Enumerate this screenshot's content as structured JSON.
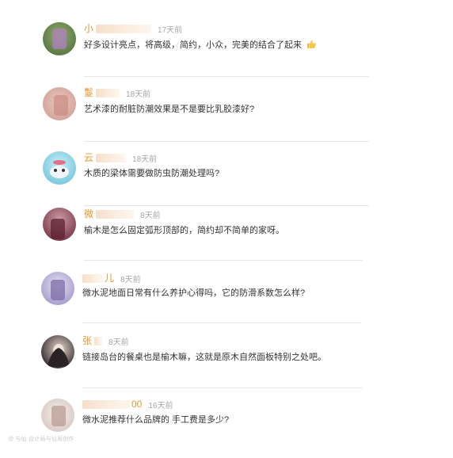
{
  "comments": [
    {
      "name": "小",
      "time": "17天前",
      "text": "好多设计亮点，将高级，简约，小众，完美的结合了起来",
      "has_thumb": true,
      "avatar_colors": [
        "#6f8f5a",
        "#b07fc0"
      ]
    },
    {
      "name": "鬉",
      "time": "18天前",
      "text": "艺术漆的耐脏防潮效果是不是要比乳胶漆好?",
      "avatar_colors": [
        "#e9c2b8",
        "#c98f86"
      ]
    },
    {
      "name": "云",
      "time": "18天前",
      "text": "木质的梁体需要做防虫防潮处理吗?",
      "avatar_colors": [
        "#9ad7e8",
        "#e46f8a"
      ]
    },
    {
      "name": "微",
      "time": "8天前",
      "text": "榆木是怎么固定弧形顶部的，简约却不简单的家呀。",
      "avatar_colors": [
        "#b07a86",
        "#6a2c3d"
      ]
    },
    {
      "name": "儿",
      "time": "8天前",
      "text": "微水泥地面日常有什么养护心得吗，它的防滑系数怎么样?",
      "avatar_colors": [
        "#c9c8e4",
        "#7d6aa7"
      ]
    },
    {
      "name": "张",
      "time": "8天前",
      "text": "链接岛台的餐桌也是榆木嘛，这就是原木自然面板特别之处吧。",
      "avatar_colors": [
        "#3a3235",
        "#d9c4bb"
      ]
    },
    {
      "name": "00",
      "time": "16天前",
      "text": "微水泥推荐什么品牌的  手工费是多少?",
      "avatar_colors": [
        "#ece5e3",
        "#c7b3ad"
      ]
    }
  ],
  "watermark": "@ 与仙 设计局与仙局创作"
}
